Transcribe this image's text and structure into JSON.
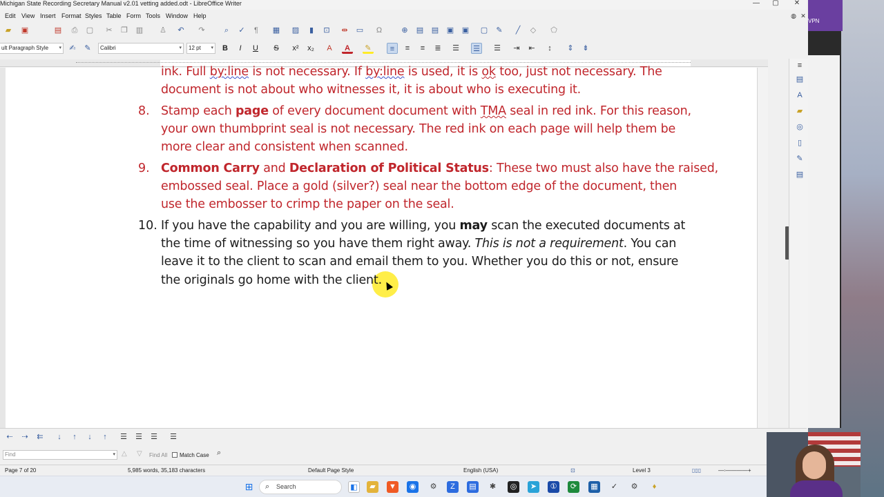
{
  "window": {
    "title": "Michigan State Recording Secretary Manual v2.01 vetting added.odt - LibreOffice Writer",
    "minimize": "—",
    "maximize": "▢",
    "close": "✕"
  },
  "menu": [
    "Edit",
    "View",
    "Insert",
    "Format",
    "Styles",
    "Table",
    "Form",
    "Tools",
    "Window",
    "Help"
  ],
  "formatting": {
    "paragraph_style": "ult Paragraph Style",
    "font_name": "Calibri",
    "font_size": "12 pt"
  },
  "document": {
    "line_top_pre": "ink. Full ",
    "line_top_byline1": "by:line",
    "line_top_mid1": " is not necessary. If ",
    "line_top_byline2": "by:line",
    "line_top_mid2": " is used, it is ",
    "line_top_ok": "ok",
    "line_top_post": " too, just not necessary. The",
    "line_top2": "document is not about who witnesses it, it is about who is executing it.",
    "item8": {
      "number": "8.",
      "pre": "Stamp each ",
      "bold": "page",
      "mid": " of every document document with ",
      "tma": "TMA",
      "post": " seal in red ink. For this reason,",
      "line2": "your own thumbprint seal is not necessary. The red ink on each page will help them be",
      "line3": "more clear and consistent when scanned."
    },
    "item9": {
      "number": "9.",
      "bold1": "Common Carry",
      "and": " and ",
      "bold2": "Declaration of Political Status",
      "post": ": These two must also have the raised,",
      "line2": "embossed seal. Place a gold (silver?) seal near the bottom edge of the document, then",
      "line3": "use the embosser to crimp the paper on the seal."
    },
    "item10": {
      "number": "10.",
      "pre": "If you have the capability and you are willing, you ",
      "bold": "may",
      "post": " scan the executed documents at",
      "line2_pre": "the time of witnessing so you have them right away. ",
      "line2_italic": "This is not a requirement",
      "line2_post": ". You can",
      "line3": "leave it to the client to scan and email them to you. Whether you do this or not, ensure",
      "line4": "the originals go home with the client."
    }
  },
  "findbar": {
    "placeholder": "Find",
    "find_all": "Find All",
    "match_case": "Match Case"
  },
  "status": {
    "page": "Page 7 of 20",
    "words": "5,985 words, 35,183 characters",
    "page_style": "Default Page Style",
    "language": "English (USA)",
    "level": "Level 3"
  },
  "taskbar": {
    "search_label": "Search"
  },
  "background": {
    "vpn_label": "VPN"
  },
  "colors": {
    "accent_red": "#c0262c",
    "highlight_yellow": "#ffeb28",
    "toolbar_blue": "#3a5fa0"
  }
}
